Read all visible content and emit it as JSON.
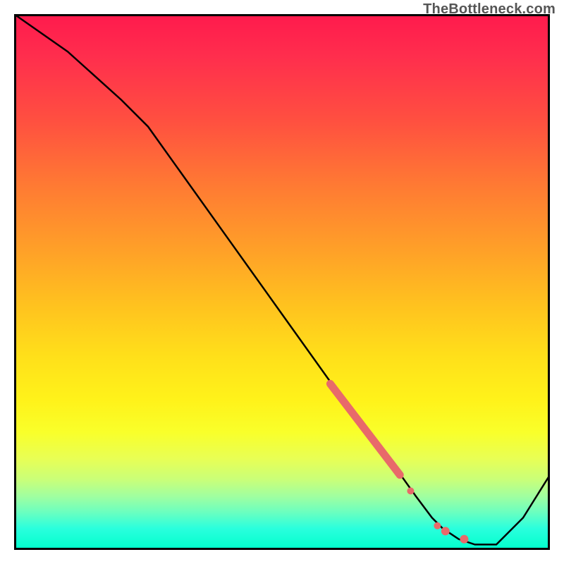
{
  "watermark": "TheBottleneck.com",
  "chart_data": {
    "type": "line",
    "title": "",
    "xlabel": "",
    "ylabel": "",
    "x_range": [
      0,
      100
    ],
    "y_range": [
      0,
      100
    ],
    "background_gradient": {
      "direction": "vertical",
      "stops": [
        {
          "pos": 0,
          "color": "#ff1a4d"
        },
        {
          "pos": 50,
          "color": "#ffd020"
        },
        {
          "pos": 80,
          "color": "#f5ff30"
        },
        {
          "pos": 100,
          "color": "#00ffcc"
        }
      ]
    },
    "series": [
      {
        "name": "curve",
        "type": "line",
        "color": "#000000",
        "x": [
          0,
          10,
          20,
          25,
          30,
          40,
          50,
          60,
          65,
          70,
          75,
          78,
          80,
          83,
          86,
          90,
          95,
          100
        ],
        "y": [
          100,
          93,
          84,
          79,
          72,
          58,
          44,
          30,
          24,
          17,
          10,
          6,
          4,
          2,
          1,
          1,
          6,
          14
        ]
      },
      {
        "name": "highlight-segment",
        "type": "line",
        "color": "#e86a6a",
        "thickness": 8,
        "x": [
          59,
          72
        ],
        "y": [
          31,
          14
        ]
      },
      {
        "name": "highlight-dots",
        "type": "scatter",
        "color": "#e86a6a",
        "points": [
          {
            "x": 74,
            "y": 11
          },
          {
            "x": 79,
            "y": 4.5
          },
          {
            "x": 80.5,
            "y": 3.5
          },
          {
            "x": 84,
            "y": 2
          }
        ]
      }
    ]
  }
}
